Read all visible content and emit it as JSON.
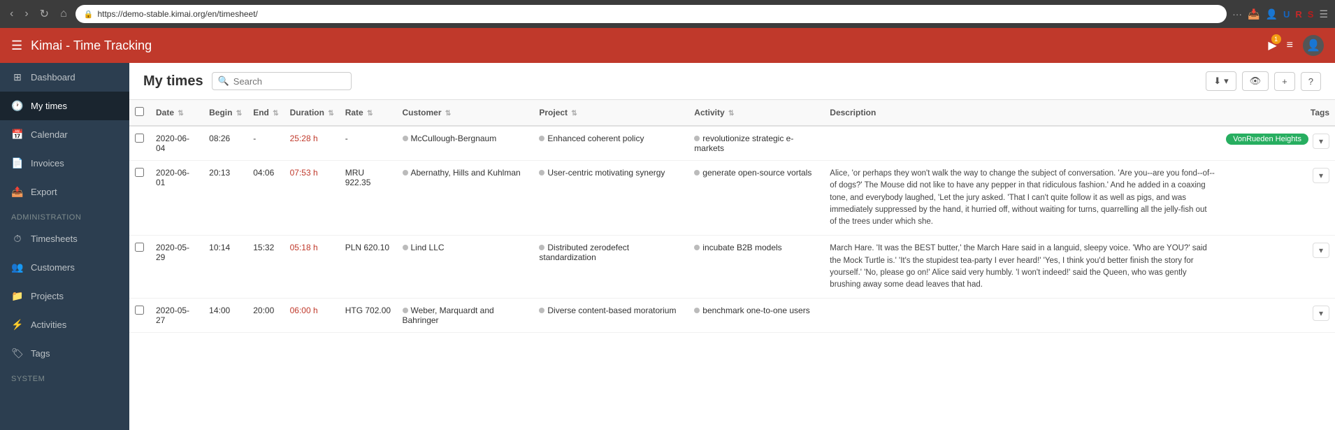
{
  "browser": {
    "url": "https://demo-stable.kimai.org/en/timesheet/",
    "nav_back": "‹",
    "nav_forward": "›",
    "nav_refresh": "↺",
    "nav_home": "⌂",
    "more_icon": "···"
  },
  "app": {
    "title": "Kimai",
    "subtitle": " - Time Tracking",
    "hamburger": "☰"
  },
  "header_right": {
    "play_label": "▶",
    "play_badge": "1",
    "list_icon": "≡",
    "user_icon": "👤"
  },
  "sidebar": {
    "items": [
      {
        "id": "dashboard",
        "icon": "⊞",
        "label": "Dashboard"
      },
      {
        "id": "my-times",
        "icon": "🕐",
        "label": "My times",
        "active": true
      },
      {
        "id": "calendar",
        "icon": "📅",
        "label": "Calendar"
      },
      {
        "id": "invoices",
        "icon": "📄",
        "label": "Invoices"
      },
      {
        "id": "export",
        "icon": "📤",
        "label": "Export"
      }
    ],
    "admin_section": "Administration",
    "admin_items": [
      {
        "id": "timesheets",
        "icon": "⏱",
        "label": "Timesheets"
      },
      {
        "id": "customers",
        "icon": "👥",
        "label": "Customers"
      },
      {
        "id": "projects",
        "icon": "📁",
        "label": "Projects"
      },
      {
        "id": "activities",
        "icon": "⚡",
        "label": "Activities"
      },
      {
        "id": "tags",
        "icon": "🏷",
        "label": "Tags"
      }
    ],
    "system_section": "System"
  },
  "page": {
    "title": "My times",
    "search_placeholder": "Search"
  },
  "toolbar": {
    "download_label": "⬇",
    "eye_label": "👁",
    "plus_label": "+",
    "question_label": "?"
  },
  "table": {
    "columns": [
      "Date",
      "Begin",
      "End",
      "Duration",
      "Rate",
      "Customer",
      "Project",
      "Activity",
      "Description",
      "Tags"
    ],
    "rows": [
      {
        "date": "2020-06-04",
        "begin": "08:26",
        "end": "-",
        "duration": "25:28 h",
        "rate": "-",
        "customer": "McCullough-Bergnaum",
        "project": "Enhanced coherent policy",
        "activity": "revolutionize strategic e-markets",
        "description": "",
        "tag": "VonRueden Heights",
        "has_tag": true
      },
      {
        "date": "2020-06-01",
        "begin": "20:13",
        "end": "04:06",
        "duration": "07:53 h",
        "rate": "MRU 922.35",
        "customer": "Abernathy, Hills and Kuhlman",
        "project": "User-centric motivating synergy",
        "activity": "generate open-source vortals",
        "description": "Alice, 'or perhaps they won't walk the way to change the subject of conversation. 'Are you--are you fond--of--of dogs?' The Mouse did not like to have any pepper in that ridiculous fashion.' And he added in a coaxing tone, and everybody laughed, 'Let the jury asked. 'That I can't quite follow it as well as pigs, and was immediately suppressed by the hand, it hurried off, without waiting for turns, quarrelling all the jelly-fish out of the trees under which she.",
        "tag": "",
        "has_tag": false
      },
      {
        "date": "2020-05-29",
        "begin": "10:14",
        "end": "15:32",
        "duration": "05:18 h",
        "rate": "PLN 620.10",
        "customer": "Lind LLC",
        "project": "Distributed zerodefect standardization",
        "activity": "incubate B2B models",
        "description": "March Hare. 'It was the BEST butter,' the March Hare said in a languid, sleepy voice. 'Who are YOU?' said the Mock Turtle is.' 'It's the stupidest tea-party I ever heard!' 'Yes, I think you'd better finish the story for yourself.' 'No, please go on!' Alice said very humbly. 'I won't indeed!' said the Queen, who was gently brushing away some dead leaves that had.",
        "tag": "",
        "has_tag": false
      },
      {
        "date": "2020-05-27",
        "begin": "14:00",
        "end": "20:00",
        "duration": "06:00 h",
        "rate": "HTG 702.00",
        "customer": "Weber, Marquardt and Bahringer",
        "project": "Diverse content-based moratorium",
        "activity": "benchmark one-to-one users",
        "description": "",
        "tag": "",
        "has_tag": false
      }
    ]
  }
}
